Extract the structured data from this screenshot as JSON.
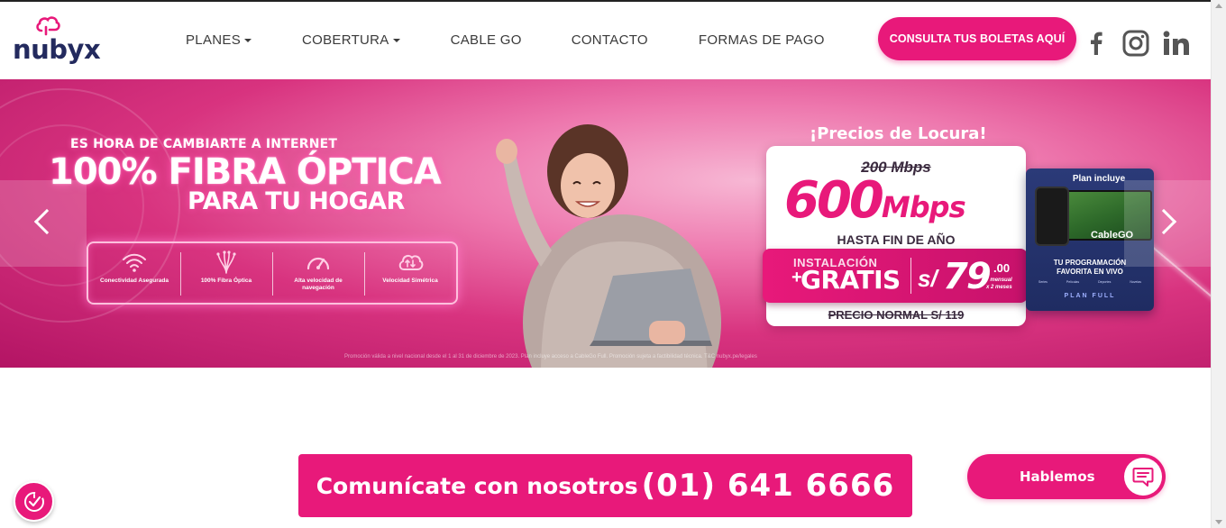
{
  "brand": {
    "logo_text": "nubyx",
    "accent": "#e8197a",
    "navy": "#232a5e"
  },
  "nav": {
    "items": [
      {
        "label": "PLANES",
        "dropdown": true
      },
      {
        "label": "COBERTURA",
        "dropdown": true
      },
      {
        "label": "CABLE GO",
        "dropdown": false
      },
      {
        "label": "CONTACTO",
        "dropdown": false
      },
      {
        "label": "FORMAS DE PAGO",
        "dropdown": false
      }
    ],
    "cta_label": "CONSULTA TUS BOLETAS AQUÍ",
    "social": [
      "facebook-icon",
      "instagram-icon",
      "linkedin-icon"
    ]
  },
  "banner": {
    "headline_small": "ES HORA DE CAMBIARTE A INTERNET",
    "headline_big": "100% FIBRA ÓPTICA",
    "headline_sub": "PARA TU HOGAR",
    "features": [
      {
        "icon": "wifi-icon",
        "label": "Conectividad Asegurada"
      },
      {
        "icon": "fiber-icon",
        "label": "100% Fibra Óptica"
      },
      {
        "icon": "speedometer-icon",
        "label": "Alta velocidad de navegación"
      },
      {
        "icon": "cloud-sync-icon",
        "label": "Velocidad Simétrica"
      }
    ],
    "offer": {
      "title": "¡Precios de Locura!",
      "old_speed": "200 Mbps",
      "new_speed_number": "600",
      "new_speed_unit": "Mbps",
      "until": "HASTA FIN DE AÑO",
      "install_small": "INSTALACIÓN",
      "install_plus": "+",
      "install_big": "GRATIS",
      "currency": "s/",
      "price": "79",
      "price_cents": ".00",
      "price_per_line1": "mensual",
      "price_per_line2": "x 2 meses",
      "normal_price": "PRECIO NORMAL S/ 119"
    },
    "plan": {
      "title": "Plan incluye",
      "brand": "CableGO",
      "text_line1": "TU PROGRAMACIÓN",
      "text_line2": "FAVORITA",
      "text_line2_bold": "EN VIVO",
      "categories": [
        "Series",
        "Películas",
        "Deportes",
        "Novelas"
      ],
      "full": "PLAN FULL"
    },
    "disclaimer": "Promoción válida a nivel nacional desde el 1 al 31 de diciembre de 2023. Plan incluye acceso a CableGo Full. Promoción sujeta a factibilidad técnica. T&C nubyx.pe/legales"
  },
  "contact": {
    "text": "Comunícate con nosotros",
    "phone": "(01) 641 6666"
  },
  "chat": {
    "label": "Hablemos"
  }
}
